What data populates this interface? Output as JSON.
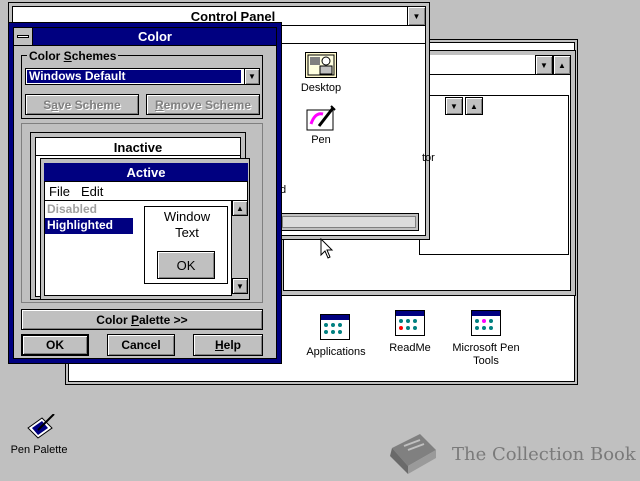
{
  "colors": {
    "desktop": "#c0c0c0",
    "active_title": "#000080",
    "highlight": "#000080",
    "disabled": "#808080"
  },
  "control_panel": {
    "title": "Control Panel",
    "icons": {
      "desktop": "Desktop",
      "pen": "Pen",
      "partial_tor": "tor",
      "partial_d": "d"
    }
  },
  "program_group": {
    "icons": {
      "applications": "Applications",
      "readme": "ReadMe",
      "pen_tools_line1": "Microsoft Pen",
      "pen_tools_line2": "Tools"
    }
  },
  "color_dialog": {
    "title": "Color",
    "schemes_group": {
      "label_before": "Color ",
      "label_underlined": "S",
      "label_after": "chemes",
      "selected_scheme": "Windows Default"
    },
    "save_button": {
      "before": "S",
      "underlined": "a",
      "after": "ve Scheme"
    },
    "remove_button": {
      "underlined": "R",
      "after": "emove Scheme"
    },
    "preview": {
      "inactive_title": "Inactive",
      "active_title": "Active",
      "menu_file": "File",
      "menu_edit": "Edit",
      "disabled_item": "Disabled",
      "highlighted_item": "Highlighted",
      "window_text_line1": "Window",
      "window_text_line2": "Text",
      "ok_label": "OK"
    },
    "palette_button": {
      "before": "Color ",
      "underlined": "P",
      "after": "alette >>"
    },
    "ok_button": "OK",
    "cancel_button": "Cancel",
    "help_button": {
      "underlined": "H",
      "after": "elp"
    }
  },
  "desktop_icons": {
    "pen_palette": "Pen Palette"
  },
  "watermark": {
    "text": "The Collection Book"
  }
}
